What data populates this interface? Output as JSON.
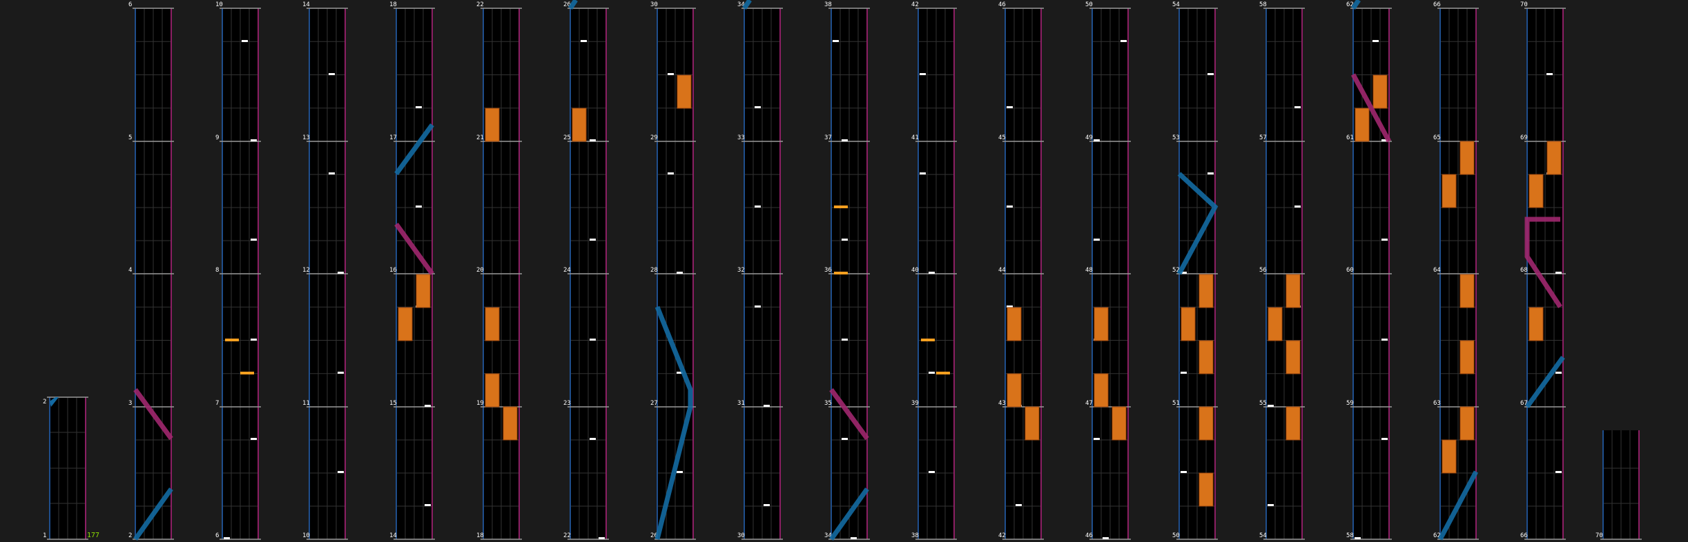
{
  "app": {
    "name": "beatmap chart preview"
  },
  "bpm_label": "177",
  "colors": {
    "background": "#1b1b1b",
    "lane_fill": "#000000",
    "grid_line": "#333333",
    "left_edge": "#1f4e8c",
    "right_edge": "#8c1f64",
    "measure_line": "#9a9a9a",
    "bt_note": "#ffffff",
    "fx_chip": "#ffa020",
    "fx_long": "#d9731a",
    "laser_left": "#136aa2",
    "laser_right": "#a0276e",
    "bpm_text": "#8ee000",
    "label_text": "#ffffff"
  },
  "columns": [
    {
      "bottom_label": "1",
      "top_label": "2",
      "measures": [
        []
      ],
      "extra": "bpm"
    },
    {
      "bottom_label": "2",
      "top_label": "6",
      "measures": [
        [],
        [],
        [],
        []
      ]
    },
    {
      "bottom_label": "6",
      "top_label": "10",
      "measures": [
        [],
        [],
        [],
        []
      ]
    },
    {
      "bottom_label": "10",
      "top_label": "14",
      "measures": [
        [],
        [],
        [],
        []
      ]
    },
    {
      "bottom_label": "14",
      "top_label": "18",
      "measures": [
        [],
        [],
        [],
        []
      ]
    },
    {
      "bottom_label": "18",
      "top_label": "22",
      "measures": [
        [],
        [],
        [],
        []
      ]
    },
    {
      "bottom_label": "22",
      "top_label": "26",
      "measures": [
        [],
        [],
        [],
        []
      ]
    },
    {
      "bottom_label": "26",
      "top_label": "30",
      "measures": [
        [],
        [],
        [],
        []
      ]
    },
    {
      "bottom_label": "30",
      "top_label": "34",
      "measures": [
        [],
        [],
        [],
        []
      ]
    },
    {
      "bottom_label": "34",
      "top_label": "38",
      "measures": [
        [],
        [],
        [],
        []
      ]
    },
    {
      "bottom_label": "38",
      "top_label": "42",
      "measures": [
        [],
        [],
        [],
        []
      ]
    },
    {
      "bottom_label": "42",
      "top_label": "46",
      "measures": [
        [],
        [],
        [],
        []
      ]
    },
    {
      "bottom_label": "46",
      "top_label": "50",
      "measures": [
        [],
        [],
        [],
        []
      ]
    },
    {
      "bottom_label": "50",
      "top_label": "54",
      "measures": [
        [],
        [],
        [],
        []
      ]
    },
    {
      "bottom_label": "54",
      "top_label": "58",
      "measures": [
        [],
        [],
        [],
        []
      ]
    },
    {
      "bottom_label": "58",
      "top_label": "62",
      "measures": [
        [],
        [],
        [],
        []
      ]
    },
    {
      "bottom_label": "62",
      "top_label": "66",
      "measures": [
        [],
        [],
        [],
        []
      ]
    },
    {
      "bottom_label": "66",
      "top_label": "70",
      "measures": [
        [],
        [],
        [],
        []
      ]
    },
    {
      "bottom_label": "70",
      "top_label": "",
      "measures": [
        []
      ]
    }
  ],
  "measure_labels": {
    "col1": [
      "2",
      "3",
      "4",
      "5",
      "6"
    ],
    "col2": [
      "6",
      "7",
      "8",
      "9",
      "10"
    ],
    "col3": [
      "10",
      "11",
      "12",
      "13",
      "14"
    ],
    "col4": [
      "14",
      "15",
      "16",
      "17",
      "18"
    ],
    "col5": [
      "18",
      "19",
      "20",
      "21",
      "22"
    ],
    "col6": [
      "22",
      "23",
      "24",
      "25",
      "26"
    ],
    "col7": [
      "26",
      "27",
      "28",
      "29",
      "30"
    ],
    "col8": [
      "30",
      "31",
      "32",
      "33",
      "34"
    ],
    "col9": [
      "34",
      "35",
      "36",
      "37",
      "38"
    ],
    "col10": [
      "38",
      "39",
      "40",
      "41",
      "42"
    ],
    "col11": [
      "42",
      "43",
      "44",
      "45",
      "46"
    ],
    "col12": [
      "46",
      "47",
      "48",
      "49",
      "50"
    ],
    "col13": [
      "50",
      "51",
      "52",
      "53",
      "54"
    ],
    "col14": [
      "54",
      "55",
      "56",
      "57",
      "58"
    ],
    "col15": [
      "58",
      "59",
      "60",
      "61",
      "62"
    ],
    "col16": [
      "62",
      "63",
      "64",
      "65",
      "66"
    ],
    "col17": [
      "66",
      "67",
      "68",
      "69",
      "70"
    ]
  }
}
